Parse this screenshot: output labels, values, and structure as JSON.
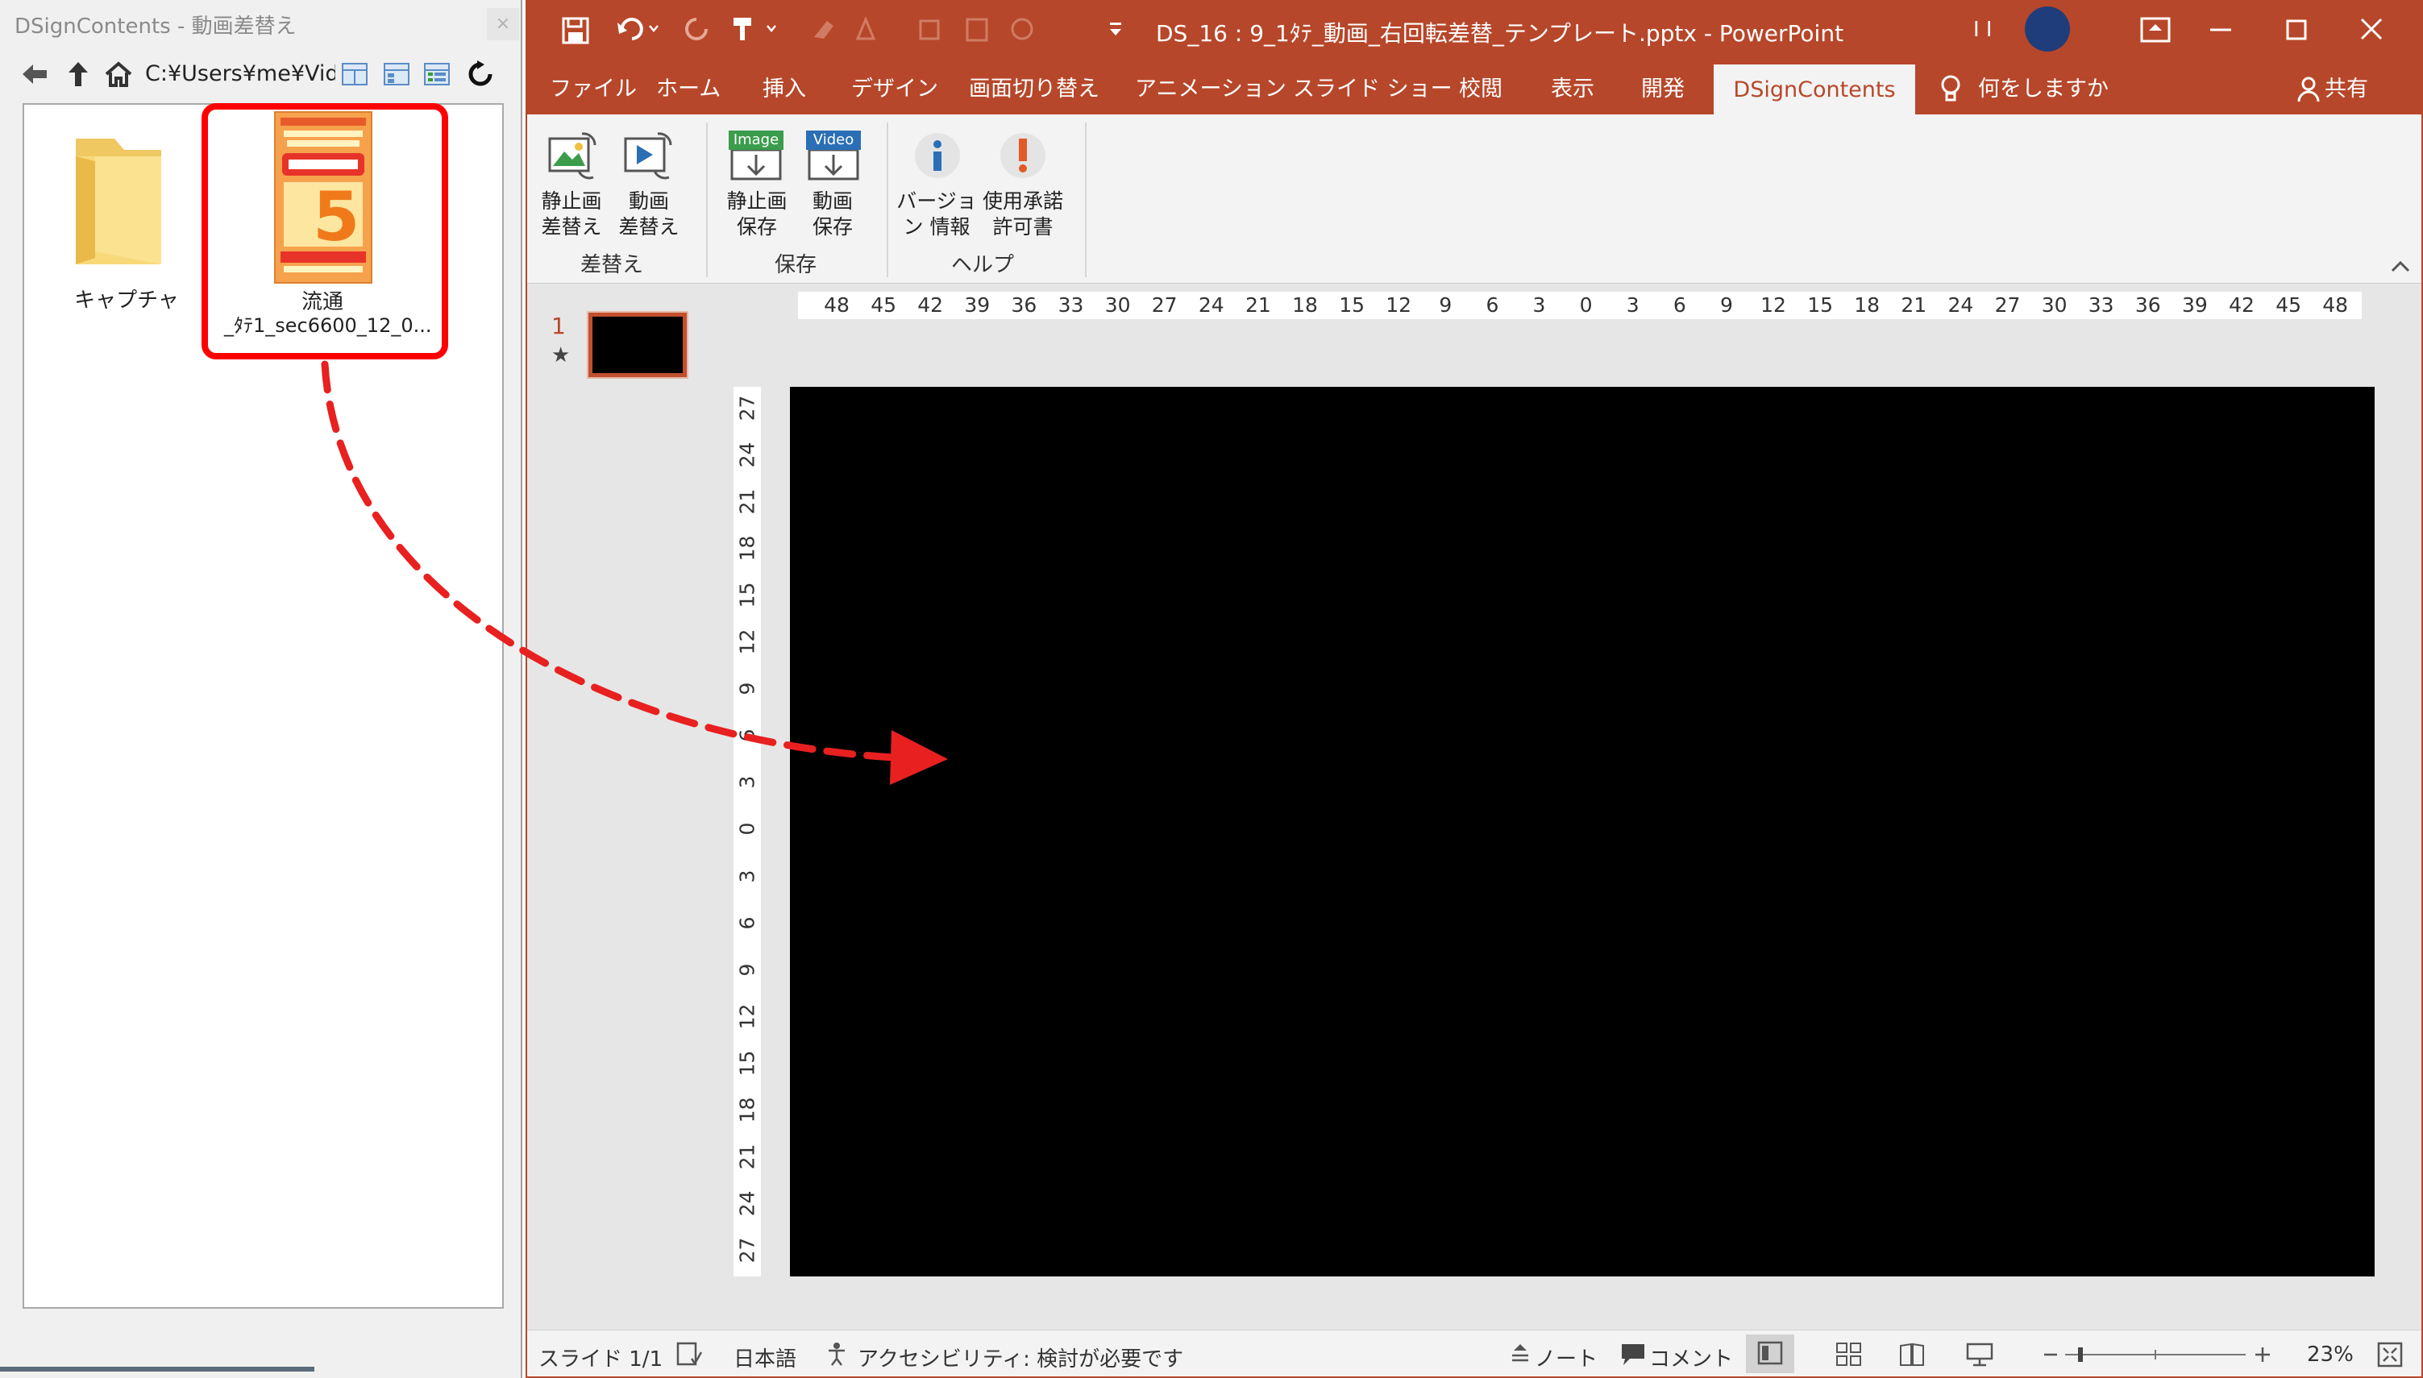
{
  "left_panel": {
    "title": "DSignContents - 動画差替え",
    "close_label": "×",
    "path": "C:¥Users¥me¥Videc",
    "items": [
      {
        "label": "キャプチャ",
        "type": "folder"
      },
      {
        "label_line1": "流通",
        "label_line2": "_ﾀﾃ1_sec6600_12_0...",
        "type": "image-file"
      }
    ]
  },
  "ppt": {
    "title": "DS_16 : 9_1ﾀﾃ_動画_右回転差替_テンプレート.pptx  -  PowerPoint",
    "title_initials": "I I",
    "tabs": [
      "ファイル",
      "ホーム",
      "挿入",
      "デザイン",
      "画面切り替え",
      "アニメーション",
      "スライド ショー",
      "校閲",
      "表示",
      "開発",
      "DSignContents",
      "何をしますか"
    ],
    "share_label": "共有",
    "ribbon": {
      "groups": [
        {
          "label": "差替え",
          "buttons": [
            {
              "line1": "静止画",
              "line2": "差替え"
            },
            {
              "line1": "動画",
              "line2": "差替え"
            }
          ]
        },
        {
          "label": "保存",
          "buttons": [
            {
              "line1": "静止画",
              "line2": "保存",
              "badge": "Image"
            },
            {
              "line1": "動画",
              "line2": "保存",
              "badge": "Video"
            }
          ]
        },
        {
          "label": "ヘルプ",
          "buttons": [
            {
              "line1": "バージョ",
              "line2": "ン 情報"
            },
            {
              "line1": "使用承諾",
              "line2": "許可書"
            }
          ]
        }
      ]
    },
    "thumbnail": {
      "number": "1",
      "star": "★"
    },
    "hruler_ticks": [
      "48",
      "45",
      "42",
      "39",
      "36",
      "33",
      "30",
      "27",
      "24",
      "21",
      "18",
      "15",
      "12",
      "9",
      "6",
      "3",
      "0",
      "3",
      "6",
      "9",
      "12",
      "15",
      "18",
      "21",
      "24",
      "27",
      "30",
      "33",
      "36",
      "39",
      "42",
      "45",
      "48"
    ],
    "vruler_ticks": [
      "27",
      "24",
      "21",
      "18",
      "15",
      "12",
      "9",
      "6",
      "3",
      "0",
      "3",
      "6",
      "9",
      "12",
      "15",
      "18",
      "21",
      "24",
      "27"
    ],
    "status": {
      "slide": "スライド 1/1",
      "language": "日本語",
      "accessibility": "アクセシビリティ: 検討が必要です",
      "notes": "ノート",
      "comments": "コメント",
      "zoom": "23%"
    },
    "colors": {
      "accent": "#b7472a",
      "highlight": "#ff0000"
    }
  }
}
